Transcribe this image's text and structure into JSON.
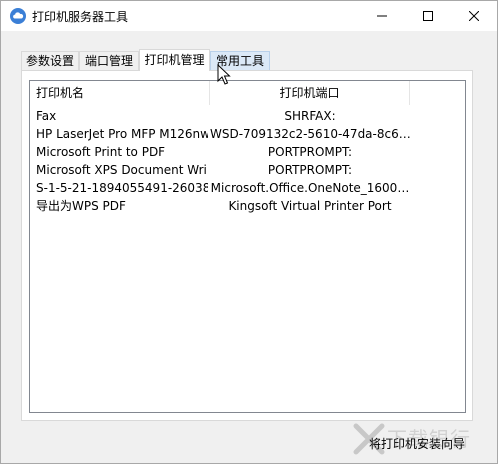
{
  "window": {
    "title": "打印机服务器工具"
  },
  "tabs": [
    {
      "label": "参数设置",
      "selected": false
    },
    {
      "label": "端口管理",
      "selected": false
    },
    {
      "label": "打印机管理",
      "selected": true
    },
    {
      "label": "常用工具",
      "selected": false,
      "hover": true
    }
  ],
  "printer_list": {
    "columns": [
      "打印机名",
      "打印机端口"
    ],
    "rows": [
      {
        "name": "Fax",
        "port": "SHRFAX:"
      },
      {
        "name": "HP LaserJet Pro MFP M126nw",
        "port": "WSD-709132c2-5610-47da-8c6…"
      },
      {
        "name": "Microsoft Print to PDF",
        "port": "PORTPROMPT:"
      },
      {
        "name": "Microsoft XPS Document Wri…",
        "port": "PORTPROMPT:"
      },
      {
        "name": "S-1-5-21-1894055491-26038…",
        "port": "Microsoft.Office.OneNote_1600…"
      },
      {
        "name": "导出为WPS PDF",
        "port": "Kingsoft Virtual Printer Port"
      }
    ]
  },
  "footer": {
    "wizard_link": "将打印机安装向导"
  },
  "watermark": {
    "text": "下载银行"
  },
  "icons": {
    "app": "cloud-app-icon",
    "minimize": "minimize-icon",
    "maximize": "maximize-icon",
    "close": "close-icon",
    "cursor": "mouse-cursor-icon"
  },
  "colors": {
    "hover_tab": "#dbe9f7",
    "app_icon": "#3b7fd6"
  }
}
